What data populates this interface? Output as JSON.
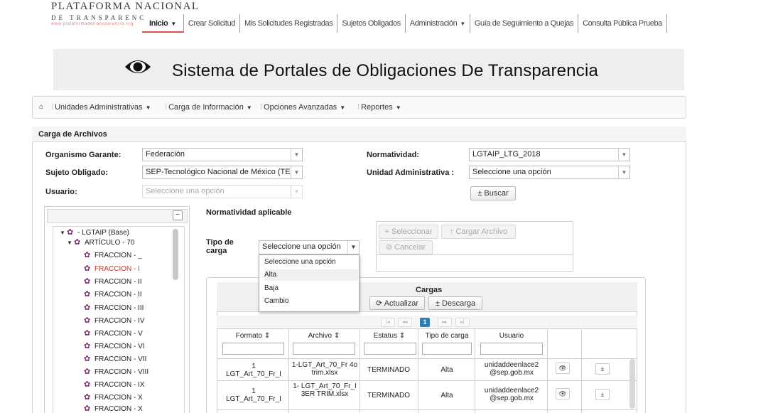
{
  "header": {
    "logo_title": "PLATAFORMA NACIONAL",
    "logo_subtitle": "DE TRANSPARENC",
    "logo_url": "www.plataformadetransparencia.org",
    "nav": [
      {
        "label": "Inicio",
        "active": true,
        "has_caret": true
      },
      {
        "label": "Crear Solicitud"
      },
      {
        "label": "Mis Solicitudes Registradas"
      },
      {
        "label": "Sujetos Obligados"
      },
      {
        "label": "Administración",
        "has_caret": true
      },
      {
        "label": "Guía de Seguimiento a Quejas"
      },
      {
        "label": "Consulta Pública Prueba"
      }
    ]
  },
  "banner": {
    "title": "Sistema de Portales de Obligaciones De Transparencia"
  },
  "subnav": {
    "items": [
      {
        "label": "Unidades Administrativas"
      },
      {
        "label": "Carga de Información"
      },
      {
        "label": "Opciones Avanzadas"
      },
      {
        "label": "Reportes"
      }
    ]
  },
  "panel": {
    "title": "Carga de Archivos",
    "fields": {
      "organismo_label": "Organismo Garante:",
      "organismo_value": "Federación",
      "sujeto_label": "Sujeto Obligado:",
      "sujeto_value": "SEP-Tecnológico Nacional de México (TECNM",
      "usuario_label": "Usuario:",
      "usuario_placeholder": "Seleccione una opción",
      "normatividad_label": "Normatividad:",
      "normatividad_value": "LGTAIP_LTG_2018",
      "unidad_label": "Unidad Administrativa :",
      "unidad_value": "Seleccione una opción",
      "buscar_label": "Buscar"
    },
    "normatividad_aplicable": "Normatividad aplicable",
    "tipo_carga_label": "Tipo de carga",
    "tipo_carga_value": "Seleccione una opción",
    "tipo_carga_options": [
      "Seleccione una opción",
      "Alta",
      "Baja",
      "Cambio"
    ],
    "actions": {
      "seleccionar": "Seleccionar",
      "cargar": "Cargar Archivo",
      "cancelar": "Cancelar"
    }
  },
  "tree": {
    "nodes": [
      {
        "label": "- LGTAIP (Base)",
        "level": 0,
        "expanded": true
      },
      {
        "label": "ARTÍCULO - 70",
        "level": 1,
        "expanded": true
      },
      {
        "label": "FRACCION - _",
        "level": 2
      },
      {
        "label": "FRACCION - I",
        "level": 2,
        "selected": true
      },
      {
        "label": "FRACCION - II",
        "level": 2
      },
      {
        "label": "FRACCION - II",
        "level": 2
      },
      {
        "label": "FRACCION - III",
        "level": 2
      },
      {
        "label": "FRACCION - IV",
        "level": 2
      },
      {
        "label": "FRACCION - V",
        "level": 2
      },
      {
        "label": "FRACCION - VI",
        "level": 2
      },
      {
        "label": "FRACCION - VII",
        "level": 2
      },
      {
        "label": "FRACCION - VIII",
        "level": 2
      },
      {
        "label": "FRACCION - IX",
        "level": 2
      },
      {
        "label": "FRACCION - X",
        "level": 2
      },
      {
        "label": "FRACCION - X",
        "level": 2
      }
    ]
  },
  "cargas": {
    "title": "Cargas",
    "actualizar": "Actualizar",
    "descarga": "Descarga",
    "page": "1",
    "columns": [
      "Formato",
      "Archivo",
      "Estatus",
      "Tipo de carga",
      "Usuario"
    ],
    "rows": [
      {
        "formato_1": "1",
        "formato_2": "LGT_Art_70_Fr_I",
        "archivo": "1-LGT_Art_70_Fr 4o trim.xlsx",
        "estatus": "TERMINADO",
        "tipo": "Alta",
        "usuario": "unidaddeenlace2 @sep.gob.mx"
      },
      {
        "formato_1": "1",
        "formato_2": "LGT_Art_70_Fr_I",
        "archivo": "1- LGT_Art_70_Fr_I 3ER TRIM.xlsx",
        "estatus": "TERMINADO",
        "tipo": "Alta",
        "usuario": "unidaddeenlace2 @sep.gob.mx"
      }
    ]
  },
  "icons": {
    "home": "home-icon",
    "eye": "eye-icon",
    "view": "view-icon",
    "download": "download-icon"
  }
}
